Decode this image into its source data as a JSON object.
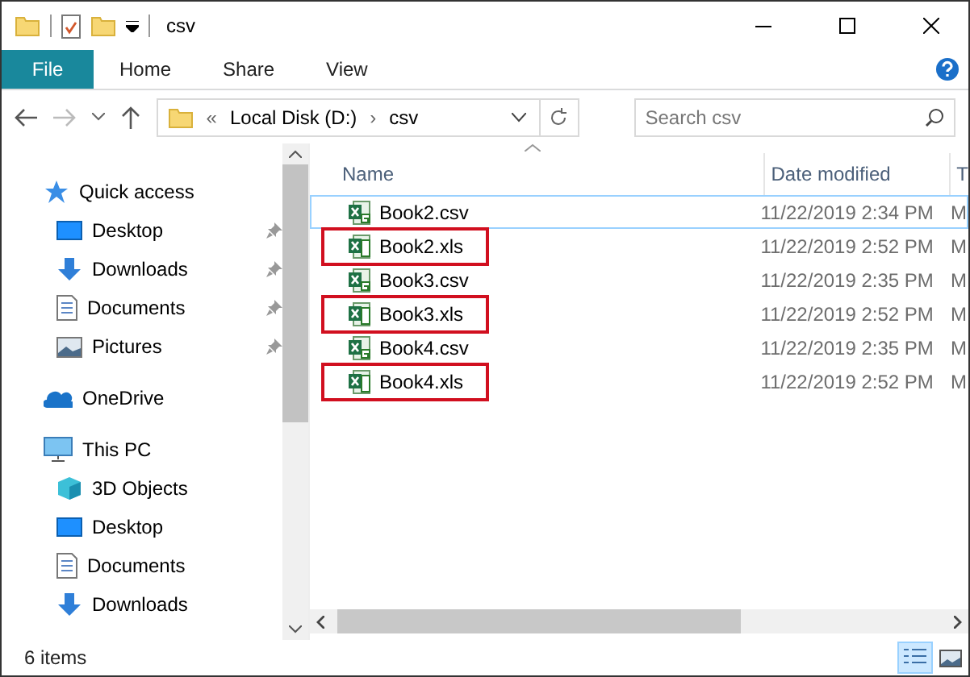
{
  "window": {
    "title": "csv"
  },
  "ribbon": {
    "tabs": [
      {
        "label": "File",
        "kind": "file",
        "selected": false
      },
      {
        "label": "Home",
        "kind": "tab",
        "selected": false
      },
      {
        "label": "Share",
        "kind": "tab",
        "selected": false
      },
      {
        "label": "View",
        "kind": "tab",
        "selected": false
      }
    ]
  },
  "address_bar": {
    "overflow": "«",
    "path": [
      "Local Disk (D:)",
      "csv"
    ],
    "separator": "›"
  },
  "search": {
    "placeholder": "Search csv"
  },
  "navigation": [
    {
      "label": "Quick access",
      "kind": "star",
      "children": [
        {
          "label": "Desktop",
          "kind": "desktop",
          "pinned": true
        },
        {
          "label": "Downloads",
          "kind": "downloads",
          "pinned": true
        },
        {
          "label": "Documents",
          "kind": "documents",
          "pinned": true
        },
        {
          "label": "Pictures",
          "kind": "pictures",
          "pinned": true
        }
      ]
    },
    {
      "label": "OneDrive",
      "kind": "cloud"
    },
    {
      "label": "This PC",
      "kind": "pc",
      "children": [
        {
          "label": "3D Objects",
          "kind": "cube",
          "pinned": false
        },
        {
          "label": "Desktop",
          "kind": "desktop",
          "pinned": false
        },
        {
          "label": "Documents",
          "kind": "documents",
          "pinned": false
        },
        {
          "label": "Downloads",
          "kind": "downloads",
          "pinned": false
        }
      ]
    }
  ],
  "table": {
    "columns": [
      "Name",
      "Date modified",
      "T"
    ],
    "rows": [
      {
        "name": "Book2.csv",
        "kind": "csv",
        "date": "11/22/2019 2:34 PM",
        "column_3": "M",
        "focused": true,
        "highlighted": false
      },
      {
        "name": "Book2.xls",
        "kind": "xls",
        "date": "11/22/2019 2:52 PM",
        "column_3": "M",
        "focused": false,
        "highlighted": true
      },
      {
        "name": "Book3.csv",
        "kind": "csv",
        "date": "11/22/2019 2:35 PM",
        "column_3": "M",
        "focused": false,
        "highlighted": false
      },
      {
        "name": "Book3.xls",
        "kind": "xls",
        "date": "11/22/2019 2:52 PM",
        "column_3": "M",
        "focused": false,
        "highlighted": true
      },
      {
        "name": "Book4.csv",
        "kind": "csv",
        "date": "11/22/2019 2:35 PM",
        "column_3": "M",
        "focused": false,
        "highlighted": false
      },
      {
        "name": "Book4.xls",
        "kind": "xls",
        "date": "11/22/2019 2:52 PM",
        "column_3": "M",
        "focused": false,
        "highlighted": true
      }
    ]
  },
  "status_bar": {
    "item_count": "6 items",
    "view_buttons": [
      {
        "kind": "details",
        "selected": true
      },
      {
        "kind": "large_icons",
        "selected": false
      }
    ]
  }
}
